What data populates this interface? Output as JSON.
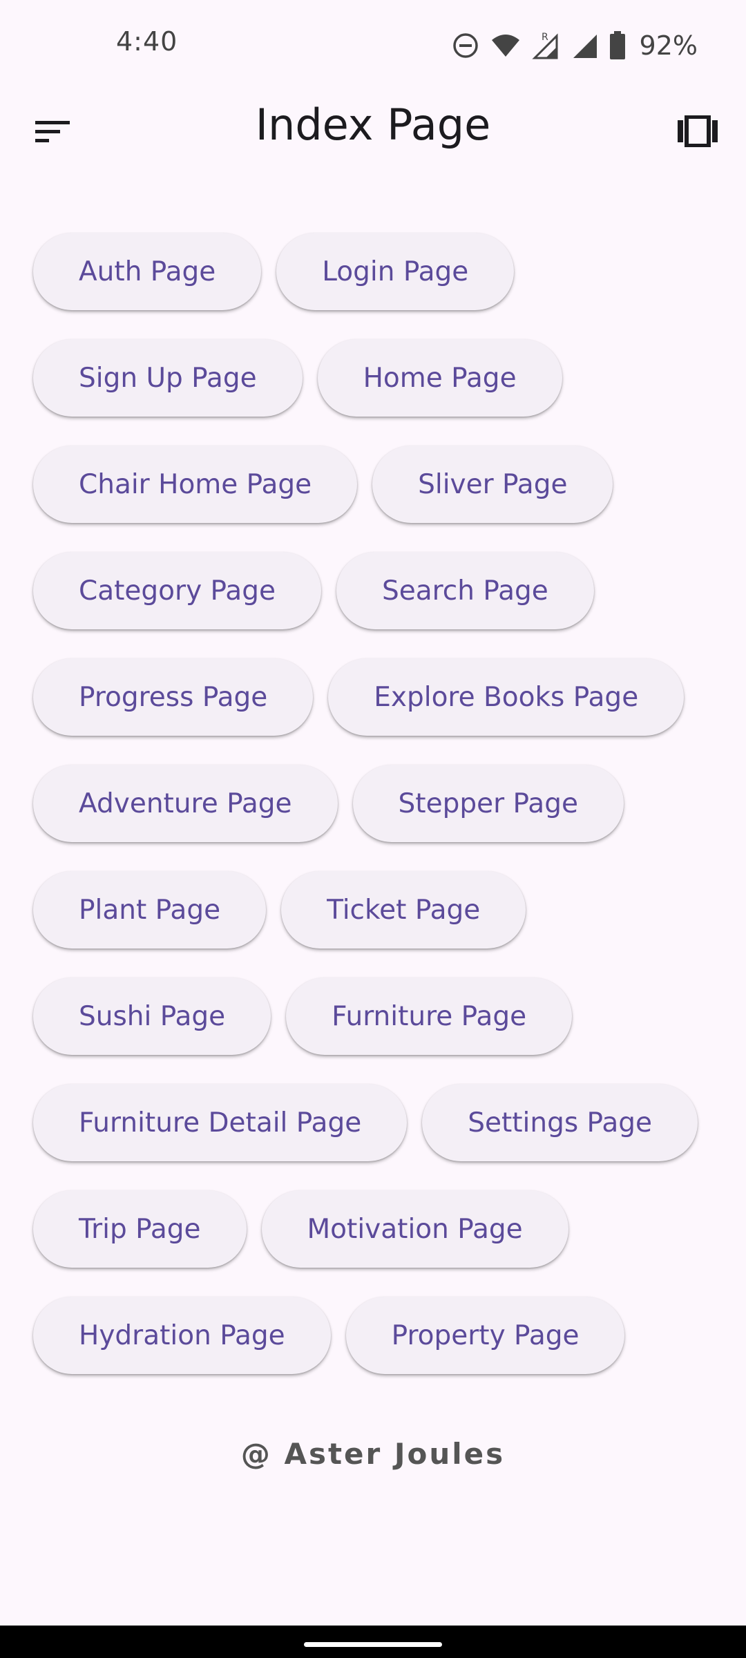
{
  "status_bar": {
    "time": "4:40",
    "battery": "92%",
    "icons": [
      "do-not-disturb-icon",
      "wifi-icon",
      "roaming-signal-icon",
      "signal-icon",
      "battery-icon"
    ]
  },
  "app_bar": {
    "title": "Index Page",
    "menu_icon": "sort-menu-icon",
    "action_icon": "view-carousel-icon"
  },
  "chips": [
    [
      "Auth Page",
      "Login Page"
    ],
    [
      "Sign Up Page",
      "Home Page"
    ],
    [
      "Chair Home Page",
      "Sliver Page"
    ],
    [
      "Category Page",
      "Search Page"
    ],
    [
      "Progress Page",
      "Explore Books Page"
    ],
    [
      "Adventure Page",
      "Stepper Page"
    ],
    [
      "Plant Page",
      "Ticket Page"
    ],
    [
      "Sushi Page",
      "Furniture Page"
    ],
    [
      "Furniture Detail Page",
      "Settings Page"
    ],
    [
      "Trip Page",
      "Motivation Page"
    ],
    [
      "Hydration Page",
      "Property Page"
    ]
  ],
  "footer": {
    "text": "@ Aster Joules"
  },
  "colors": {
    "background": "#fdf7fd",
    "chip_background": "#f4eff6",
    "chip_text": "#5b4a9a",
    "title_text": "#1c1b1f"
  }
}
